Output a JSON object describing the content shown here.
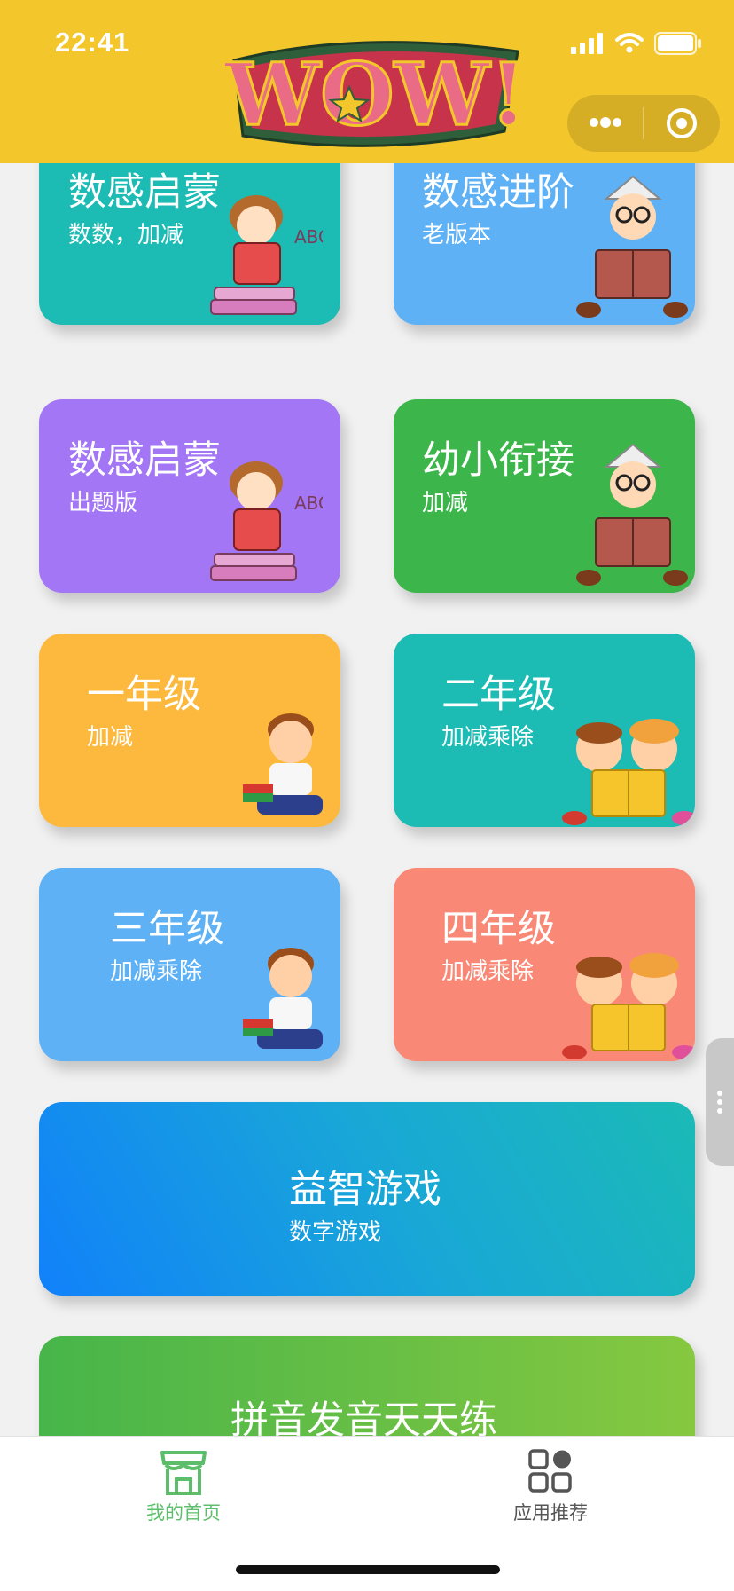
{
  "status_bar": {
    "time": "22:41"
  },
  "header": {
    "logo_text": "WOW!"
  },
  "cards": [
    {
      "id": "shugan-qimeng-1",
      "title": "数感启蒙",
      "subtitle": "数数，加减",
      "color": "#1cbcb4"
    },
    {
      "id": "shugan-jinjie",
      "title": "数感进阶",
      "subtitle": "老版本",
      "color": "#5eb1f5"
    },
    {
      "id": "shugan-qimeng-2",
      "title": "数感启蒙",
      "subtitle": "出题版",
      "color": "#a376f5"
    },
    {
      "id": "youxiao-xianjie",
      "title": "幼小衔接",
      "subtitle": "加减",
      "color": "#3cb64b"
    },
    {
      "id": "grade-1",
      "title": "一年级",
      "subtitle": "加减",
      "color": "#fdb93d"
    },
    {
      "id": "grade-2",
      "title": "二年级",
      "subtitle": "加减乘除",
      "color": "#1cbcb4"
    },
    {
      "id": "grade-3",
      "title": "三年级",
      "subtitle": "加减乘除",
      "color": "#5eb1f5"
    },
    {
      "id": "grade-4",
      "title": "四年级",
      "subtitle": "加减乘除",
      "color": "#f98876"
    },
    {
      "id": "puzzle-games",
      "title": "益智游戏",
      "subtitle": "数字游戏",
      "color": "#1e90f0"
    },
    {
      "id": "pinyin",
      "title": "拼音发音天天练",
      "subtitle": "",
      "color": "#5cbe46"
    }
  ],
  "tabbar": {
    "items": [
      {
        "label": "我的首页",
        "icon": "home-icon",
        "active": true,
        "color": "#5cbe6a"
      },
      {
        "label": "应用推荐",
        "icon": "apps-grid-icon",
        "active": false,
        "color": "#555555"
      }
    ]
  }
}
